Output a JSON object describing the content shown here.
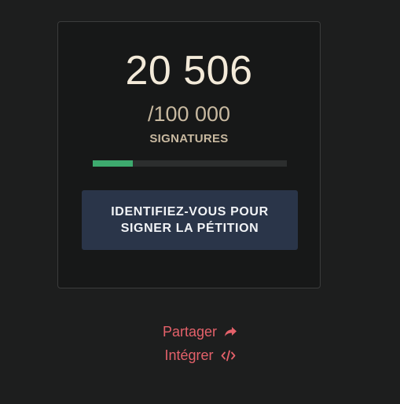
{
  "petition": {
    "signature_count": "20 506",
    "goal": "/100 000",
    "unit_label": "SIGNATURES",
    "progress_fraction": 0.20506
  },
  "sign_button": {
    "line1": "IDENTIFIEZ-VOUS POUR",
    "line2": "SIGNER LA PÉTITION"
  },
  "links": {
    "share": "Partager",
    "embed": "Intégrer"
  },
  "icons": {
    "share": "share-arrow-icon",
    "embed": "code-icon"
  },
  "colors": {
    "progress": "#3daa6e",
    "button_bg": "#2a3549",
    "link": "#e4616a"
  }
}
